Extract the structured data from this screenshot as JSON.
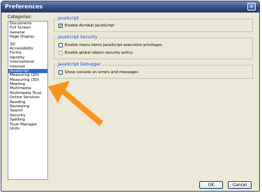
{
  "window": {
    "title": "Preferences"
  },
  "sidebar": {
    "label": "Categories:",
    "group1": [
      "Documents",
      "Full Screen",
      "General",
      "Page Display"
    ],
    "group2": [
      "3D",
      "Accessibility",
      "Forms",
      "Identity",
      "International",
      "Internet",
      "JavaScript",
      "Measuring (2D)",
      "Measuring (3D)",
      "Meeting",
      "Multimedia",
      "Multimedia Trust",
      "Online Services",
      "Reading",
      "Reviewing",
      "Search",
      "Security",
      "Spelling",
      "Trust Manager",
      "Units"
    ],
    "selected": "JavaScript"
  },
  "javascript": {
    "title": "JavaScript",
    "enable_label": "Enable Acrobat JavaScript",
    "enable_checked": true
  },
  "security": {
    "title": "JavaScript Security",
    "menu_items_label": "Enable menu items JavaScript execution privileges",
    "global_policy_label": "Enable global object security policy"
  },
  "debugger": {
    "title": "JavaScript Debugger",
    "console_label": "Show console on errors and messages"
  },
  "buttons": {
    "ok": "OK",
    "cancel": "Cancel"
  },
  "colors": {
    "arrow": "#f7941d",
    "selection": "#316ac5",
    "group_title": "#0046d5"
  }
}
